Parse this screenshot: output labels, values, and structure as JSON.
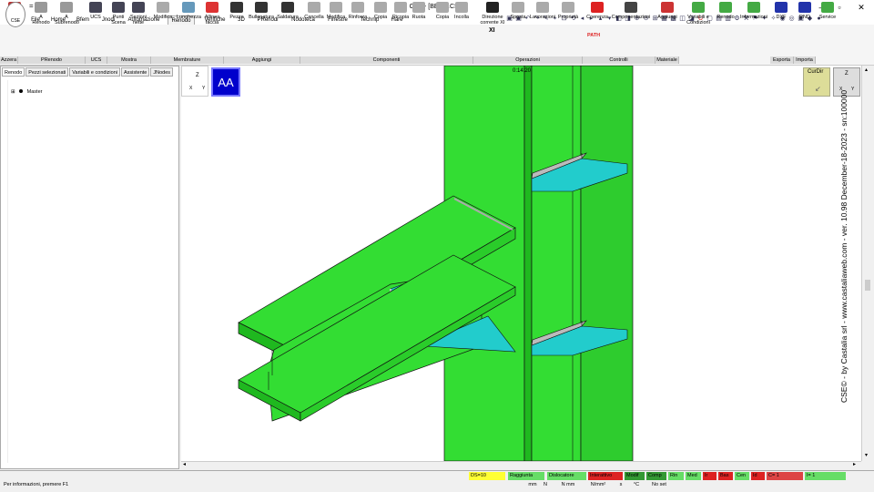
{
  "app": {
    "title": "CSE - [BECO.CSE]",
    "logo": "CSE",
    "qa_mark": "="
  },
  "window_controls": {
    "minimize": "–",
    "maximize": "▫",
    "close": "✕"
  },
  "menu": [
    "File",
    "Home",
    "Bfem",
    "Jnodi",
    "Automazione",
    "Renodo",
    "Verifiche",
    "3D",
    "PRenodi",
    "Nodoteca",
    "Finestre",
    "Technip",
    "Hare"
  ],
  "ribbon": {
    "buttons": [
      {
        "label": "Azzera",
        "icon": "eraser-icon",
        "color": "#b33"
      },
      {
        "label": "A Renodo",
        "icon": "a-renodo-icon",
        "color": "#999"
      },
      {
        "label": "A Subrenodo",
        "icon": "a-subrenodo-icon",
        "color": "#999"
      },
      {
        "label": "UCS",
        "icon": "ucs-axes-icon",
        "color": "#445"
      },
      {
        "label": "Punti Scena",
        "icon": "points-icon",
        "color": "#445"
      },
      {
        "label": "Sezioni nette",
        "icon": "sections-icon",
        "color": "#445"
      },
      {
        "label": "Modifica",
        "icon": "member-edit-icon",
        "color": "#aaa"
      },
      {
        "label": "Lunghezza",
        "icon": "length-icon",
        "color": "#69b"
      },
      {
        "label": "Allinea faccia",
        "icon": "align-face-icon",
        "color": "#d33"
      },
      {
        "label": "Pezzo",
        "icon": "piece-icon",
        "color": "#333"
      },
      {
        "label": "Bullonatura",
        "icon": "bolting-icon",
        "color": "#333"
      },
      {
        "label": "Saldatura",
        "icon": "welding-icon",
        "color": "#333"
      },
      {
        "label": "Cancella",
        "icon": "delete-icon",
        "color": "#aaa"
      },
      {
        "label": "Modifica",
        "icon": "component-edit-icon",
        "color": "#aaa"
      },
      {
        "label": "Rinforza",
        "icon": "reinforce-icon",
        "color": "#aaa"
      },
      {
        "label": "Copia",
        "icon": "copy-icon",
        "color": "#aaa"
      },
      {
        "label": "Ricopia",
        "icon": "recopy-icon",
        "color": "#aaa"
      },
      {
        "label": "Ruota",
        "icon": "rotate-icon",
        "color": "#aaa"
      },
      {
        "label": "Copia",
        "icon": "copy-op-icon",
        "color": "#aaa"
      },
      {
        "label": "Incolla",
        "icon": "paste-icon",
        "color": "#aaa"
      },
      {
        "label": "Direzione corrente XI",
        "icon": "direction-icon",
        "color": "#222"
      },
      {
        "label": "Sposta",
        "icon": "move-icon",
        "color": "#aaa"
      },
      {
        "label": "Lavorazioni",
        "icon": "machining-icon",
        "color": "#aaa"
      },
      {
        "label": "Proprietà",
        "icon": "properties-icon",
        "color": "#aaa"
      },
      {
        "label": "Coerenza",
        "icon": "path-coherence-icon",
        "color": "#d22"
      },
      {
        "label": "Componentazioni",
        "icon": "componentization-icon",
        "color": "#444"
      },
      {
        "label": "Aggiungi",
        "icon": "add-material-icon",
        "color": "#c33"
      },
      {
        "label": "Variabili e Condizioni",
        "icon": "variables-icon",
        "color": "#4a4"
      },
      {
        "label": "Renodo",
        "icon": "renodo-dot-icon",
        "color": "#4a4"
      },
      {
        "label": "Informazioni",
        "icon": "info-dot-icon",
        "color": "#4a4"
      },
      {
        "label": "DXF",
        "icon": "export-dxf-icon",
        "color": "#23a"
      },
      {
        "label": "RND",
        "icon": "import-rnd-icon",
        "color": "#23a"
      },
      {
        "label": "Service",
        "icon": "service-dot-icon",
        "color": "#4a4"
      }
    ],
    "groups": [
      "Azzera",
      "PRenodo",
      "UCS",
      "Mostra",
      "Membrature",
      "Aggiungi",
      "Componenti",
      "Operazioni",
      "Controlli",
      "Materiale",
      "Esporta",
      "Importa"
    ],
    "path_text": "PATH",
    "direction_text": "XI"
  },
  "left_panel": {
    "tabs": [
      "Renodo",
      "Pezzi selezionati",
      "Variabili e condizioni",
      "Assistente",
      "JNodes"
    ],
    "tree": [
      {
        "expander": "⊞",
        "label": "Master"
      }
    ]
  },
  "viewport": {
    "timer": "0:14:20",
    "aa_label": "AA",
    "axis_z": "Z",
    "axis_x": "X",
    "axis_y": "Y",
    "curdir_label": "CurDir",
    "watermark": "CSE© - by Castalia srl - www.castaliaweb.com - ver. 10.98 December-18-2023 - sn:100000"
  },
  "status": {
    "info": "Per informazioni, premere F1",
    "cells": [
      {
        "label": "DS=10",
        "color": "#ffff33"
      },
      {
        "label": "Raggiunta",
        "color": "#66dd66"
      },
      {
        "label": "Dislocatore",
        "color": "#66dd66"
      },
      {
        "label": "Interattivo",
        "color": "#dd2222"
      },
      {
        "label": "Modif",
        "color": "#339933"
      },
      {
        "label": "Comp",
        "color": "#339933"
      },
      {
        "label": "Rin",
        "color": "#66dd66"
      },
      {
        "label": "Med",
        "color": "#66dd66"
      },
      {
        "label": "Ir",
        "color": "#dd2222"
      },
      {
        "label": "Bas",
        "color": "#dd2222"
      },
      {
        "label": "Cen",
        "color": "#66dd66"
      },
      {
        "label": "Id",
        "color": "#dd2222"
      },
      {
        "label": "C= 1",
        "color": "#dd4444"
      },
      {
        "label": "I= 1",
        "color": "#66dd66"
      }
    ],
    "units": [
      {
        "label": "mm"
      },
      {
        "label": "N"
      },
      {
        "label": "N mm"
      },
      {
        "label": "N/mm²"
      },
      {
        "label": "s"
      },
      {
        "label": "°C"
      },
      {
        "label": "No set"
      }
    ]
  }
}
